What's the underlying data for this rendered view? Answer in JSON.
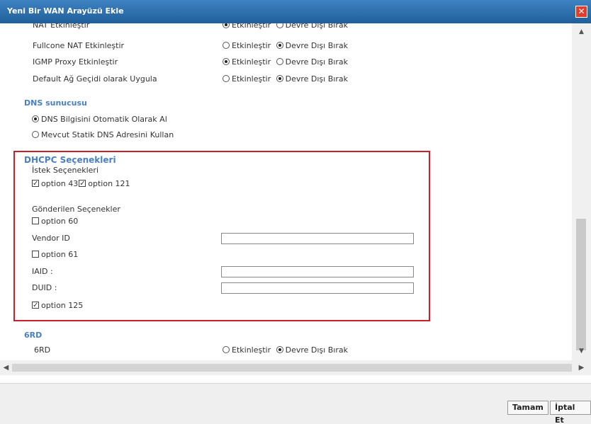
{
  "window": {
    "title": "Yeni Bir WAN Arayüzü Ekle",
    "close_symbol": "✕"
  },
  "nat_rows": [
    {
      "label": "NAT Etkinleştir",
      "opt1": "Etkinleştir",
      "opt2": "Devre Dışı Bırak",
      "selected": 1
    },
    {
      "label": "Fullcone NAT Etkinleştir",
      "opt1": "Etkinleştir",
      "opt2": "Devre Dışı Bırak",
      "selected": 2
    },
    {
      "label": "IGMP Proxy Etkinleştir",
      "opt1": "Etkinleştir",
      "opt2": "Devre Dışı Bırak",
      "selected": 1
    },
    {
      "label": "Default Ağ Geçidi olarak Uygula",
      "opt1": "Etkinleştir",
      "opt2": "Devre Dışı Bırak",
      "selected": 2
    }
  ],
  "dns": {
    "title": "DNS sunucusu",
    "option_auto": "DNS Bilgisini Otomatik Olarak Al",
    "option_static": "Mevcut Statik DNS Adresini Kullan",
    "selected": "auto"
  },
  "dhcpc": {
    "title": "DHCPC Seçenekleri",
    "request_label": "İstek Seçenekleri",
    "opt43": "option 43",
    "opt43_checked": true,
    "opt121": "option 121",
    "opt121_checked": true,
    "sent_label": "Gönderilen Seçenekler",
    "opt60": "option 60",
    "opt60_checked": false,
    "vendor_id_label": "Vendor ID",
    "vendor_id_value": "",
    "opt61": "option 61",
    "opt61_checked": false,
    "iaid_label": "IAID :",
    "iaid_value": "",
    "duid_label": "DUID :",
    "duid_value": "",
    "opt125": "option 125",
    "opt125_checked": true
  },
  "sixrd": {
    "title": "6RD",
    "label": "6RD",
    "opt1": "Etkinleştir",
    "opt2": "Devre Dışı Bırak",
    "selected": 2
  },
  "footer": {
    "ok_label": "Tamam",
    "cancel_label": "İptal Et"
  },
  "colors": {
    "title_bar": "#2e72b3",
    "section_title": "#4a7fc1",
    "highlight_box": "#c8202a"
  }
}
